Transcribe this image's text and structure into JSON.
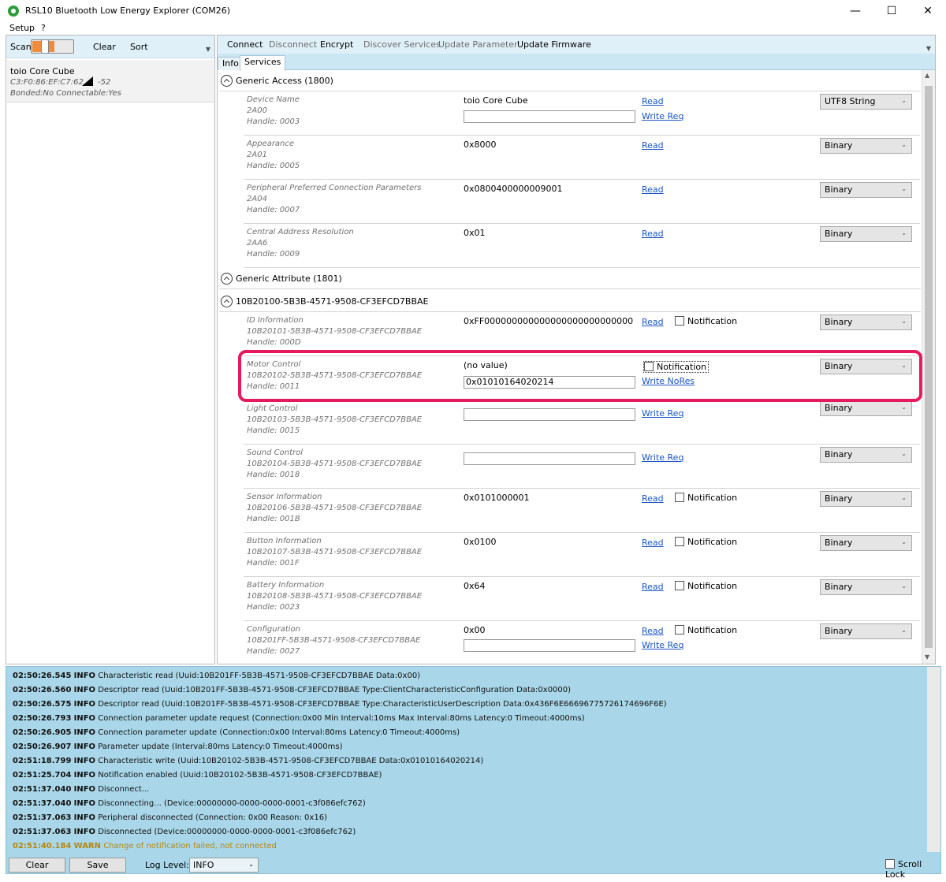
{
  "window": {
    "title": "RSL10 Bluetooth Low Energy Explorer (COM26)",
    "minimize": "—",
    "maximize": "☐",
    "close": "✕"
  },
  "menu": {
    "setup": "Setup",
    "help": "?"
  },
  "left": {
    "scan_label": "Scan",
    "clear": "Clear",
    "sort": "Sort",
    "device": {
      "name": "toio Core Cube",
      "address": "C3:F0:86:EF:C7:62",
      "rssi": "-52",
      "flags": "Bonded:No Connectable:Yes"
    }
  },
  "commands": {
    "connect": "Connect",
    "disconnect": "Disconnect",
    "encrypt": "Encrypt",
    "discover": "Discover Services",
    "update_param": "Update Parameter",
    "update_fw": "Update Firmware"
  },
  "tabs": {
    "info": "Info",
    "services": "Services"
  },
  "actions": {
    "read": "Read",
    "write_req": "Write Req",
    "write_nores": "Write NoRes",
    "notification": "Notification"
  },
  "services": {
    "generic_access": {
      "title": "Generic Access (1800)",
      "chars": [
        {
          "name": "Device Name",
          "uuid": "2A00",
          "handle": "Handle: 0003",
          "value": "toio Core Cube",
          "format": "UTF8 String"
        },
        {
          "name": "Appearance",
          "uuid": "2A01",
          "handle": "Handle: 0005",
          "value": "0x8000",
          "format": "Binary"
        },
        {
          "name": "Peripheral Preferred Connection Parameters",
          "uuid": "2A04",
          "handle": "Handle: 0007",
          "value": "0x0800400000009001",
          "format": "Binary"
        },
        {
          "name": "Central Address Resolution",
          "uuid": "2AA6",
          "handle": "Handle: 0009",
          "value": "0x01",
          "format": "Binary"
        }
      ]
    },
    "generic_attribute": {
      "title": "Generic Attribute (1801)"
    },
    "toio": {
      "title": "10B20100-5B3B-4571-9508-CF3EFCD7BBAE",
      "chars": [
        {
          "name": "ID Information",
          "uuid": "10B20101-5B3B-4571-9508-CF3EFCD7BBAE",
          "handle": "Handle: 000D",
          "value": "0xFF000000000000000000000000000",
          "format": "Binary"
        },
        {
          "name": "Motor Control",
          "uuid": "10B20102-5B3B-4571-9508-CF3EFCD7BBAE",
          "handle": "Handle: 0011",
          "value": "(no value)",
          "input": "0x01010164020214",
          "format": "Binary"
        },
        {
          "name": "Light Control",
          "uuid": "10B20103-5B3B-4571-9508-CF3EFCD7BBAE",
          "handle": "Handle: 0015",
          "format": "Binary"
        },
        {
          "name": "Sound Control",
          "uuid": "10B20104-5B3B-4571-9508-CF3EFCD7BBAE",
          "handle": "Handle: 0018",
          "format": "Binary"
        },
        {
          "name": "Sensor Information",
          "uuid": "10B20106-5B3B-4571-9508-CF3EFCD7BBAE",
          "handle": "Handle: 001B",
          "value": "0x0101000001",
          "format": "Binary"
        },
        {
          "name": "Button Information",
          "uuid": "10B20107-5B3B-4571-9508-CF3EFCD7BBAE",
          "handle": "Handle: 001F",
          "value": "0x0100",
          "format": "Binary"
        },
        {
          "name": "Battery Information",
          "uuid": "10B20108-5B3B-4571-9508-CF3EFCD7BBAE",
          "handle": "Handle: 0023",
          "value": "0x64",
          "format": "Binary"
        },
        {
          "name": "Configuration",
          "uuid": "10B201FF-5B3B-4571-9508-CF3EFCD7BBAE",
          "handle": "Handle: 0027",
          "value": "0x00",
          "format": "Binary"
        }
      ]
    }
  },
  "log": {
    "lines": [
      {
        "time": "02:50:26.545",
        "level": "INFO",
        "msg": "Characteristic read (Uuid:10B201FF-5B3B-4571-9508-CF3EFCD7BBAE Data:0x00)"
      },
      {
        "time": "02:50:26.560",
        "level": "INFO",
        "msg": "Descriptor read (Uuid:10B201FF-5B3B-4571-9508-CF3EFCD7BBAE Type:ClientCharacteristicConfiguration Data:0x0000)"
      },
      {
        "time": "02:50:26.575",
        "level": "INFO",
        "msg": "Descriptor read (Uuid:10B201FF-5B3B-4571-9508-CF3EFCD7BBAE Type:CharacteristicUserDescription Data:0x436F6E66696775726174696F6E)"
      },
      {
        "time": "02:50:26.793",
        "level": "INFO",
        "msg": "Connection parameter update request (Connection:0x00 Min Interval:10ms Max Interval:80ms Latency:0 Timeout:4000ms)"
      },
      {
        "time": "02:50:26.905",
        "level": "INFO",
        "msg": "Connection parameter update (Connection:0x00 Interval:80ms Latency:0 Timeout:4000ms)"
      },
      {
        "time": "02:50:26.907",
        "level": "INFO",
        "msg": "Parameter update (Interval:80ms Latency:0 Timeout:4000ms)"
      },
      {
        "time": "02:51:18.799",
        "level": "INFO",
        "msg": "Characteristic write (Uuid:10B20102-5B3B-4571-9508-CF3EFCD7BBAE Data:0x01010164020214)"
      },
      {
        "time": "02:51:25.704",
        "level": "INFO",
        "msg": "Notification enabled (Uuid:10B20102-5B3B-4571-9508-CF3EFCD7BBAE)"
      },
      {
        "time": "02:51:37.040",
        "level": "INFO",
        "msg": "Disconnect..."
      },
      {
        "time": "02:51:37.040",
        "level": "INFO",
        "msg": "Disconnecting... (Device:00000000-0000-0000-0001-c3f086efc762)"
      },
      {
        "time": "02:51:37.063",
        "level": "INFO",
        "msg": "Peripheral disconnected (Connection: 0x00 Reason: 0x16)"
      },
      {
        "time": "02:51:37.063",
        "level": "INFO",
        "msg": "Disconnected (Device:00000000-0000-0000-0001-c3f086efc762)"
      },
      {
        "time": "02:51:40.184",
        "level": "WARN",
        "msg": "Change of notification failed, not connected"
      }
    ],
    "clear": "Clear",
    "save": "Save",
    "level_label": "Log Level:",
    "level_value": "INFO",
    "scroll_lock": "Scroll Lock"
  },
  "colors": {
    "toolbar_bg": "#dff0f8",
    "log_bg": "#a9d7e9",
    "highlight": "#e6195e",
    "link": "#1a54c8",
    "warn": "#b8860b"
  }
}
